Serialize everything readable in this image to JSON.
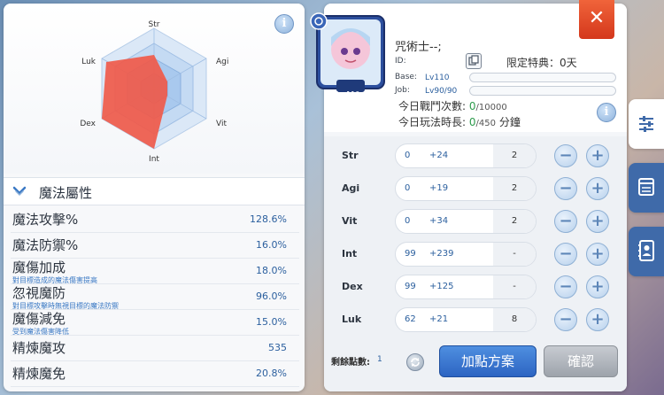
{
  "radar": {
    "labels": [
      "Str",
      "Agi",
      "Vit",
      "Int",
      "Dex",
      "Luk"
    ],
    "info_icon": "i"
  },
  "section": {
    "title": "魔法屬性"
  },
  "stats": [
    {
      "name": "魔法攻擊%",
      "value": "128.6%",
      "desc": ""
    },
    {
      "name": "魔法防禦%",
      "value": "16.0%",
      "desc": ""
    },
    {
      "name": "魔傷加成",
      "value": "18.0%",
      "desc": "對目標造成的魔法傷害提高"
    },
    {
      "name": "忽視魔防",
      "value": "96.0%",
      "desc": "對目標攻擊時無視目標的魔法防禦"
    },
    {
      "name": "魔傷減免",
      "value": "15.0%",
      "desc": "受到魔法傷害降低"
    },
    {
      "name": "精煉魔攻",
      "value": "535",
      "desc": ""
    },
    {
      "name": "精煉魔免",
      "value": "20.8%",
      "desc": ""
    }
  ],
  "profile": {
    "name": "咒術士--;",
    "id_label": "ID:",
    "limited_label": "限定特典：0天",
    "avatar_level": "Lv.110",
    "base_label": "Base:",
    "base_value": "Lv110",
    "job_label": "Job:",
    "job_value": "Lv90/90",
    "battles_label": "今日戰鬥次數:",
    "battles_value": "0",
    "battles_max": "/10000",
    "playtime_label": "今日玩法時長:",
    "playtime_value": "0",
    "playtime_max": "/450",
    "playtime_unit": "分鐘"
  },
  "alloc": [
    {
      "attr": "Str",
      "base": "0",
      "bonus": "+24",
      "pts": "2"
    },
    {
      "attr": "Agi",
      "base": "0",
      "bonus": "+19",
      "pts": "2"
    },
    {
      "attr": "Vit",
      "base": "0",
      "bonus": "+34",
      "pts": "2"
    },
    {
      "attr": "Int",
      "base": "99",
      "bonus": "+239",
      "pts": "-"
    },
    {
      "attr": "Dex",
      "base": "99",
      "bonus": "+125",
      "pts": "-"
    },
    {
      "attr": "Luk",
      "base": "62",
      "bonus": "+21",
      "pts": "8"
    }
  ],
  "footer": {
    "remaining_label": "剩餘點數:",
    "remaining_value": "1",
    "plan_button": "加點方案",
    "confirm_button": "確認"
  },
  "buttons": {
    "minus": "−",
    "plus": "+",
    "close": "✕"
  },
  "icons": {
    "side_tabs": [
      "sliders-icon",
      "calendar-icon",
      "address-book-icon"
    ],
    "reset": "refresh-icon",
    "copy": "copy-icon",
    "info": "info-icon"
  },
  "colors": {
    "accent_blue": "#2c64c2",
    "value_blue": "#2b5f9e",
    "radar_fill": "#f05a4a",
    "close_orange": "#e04a24",
    "green": "#2e9b4d"
  }
}
